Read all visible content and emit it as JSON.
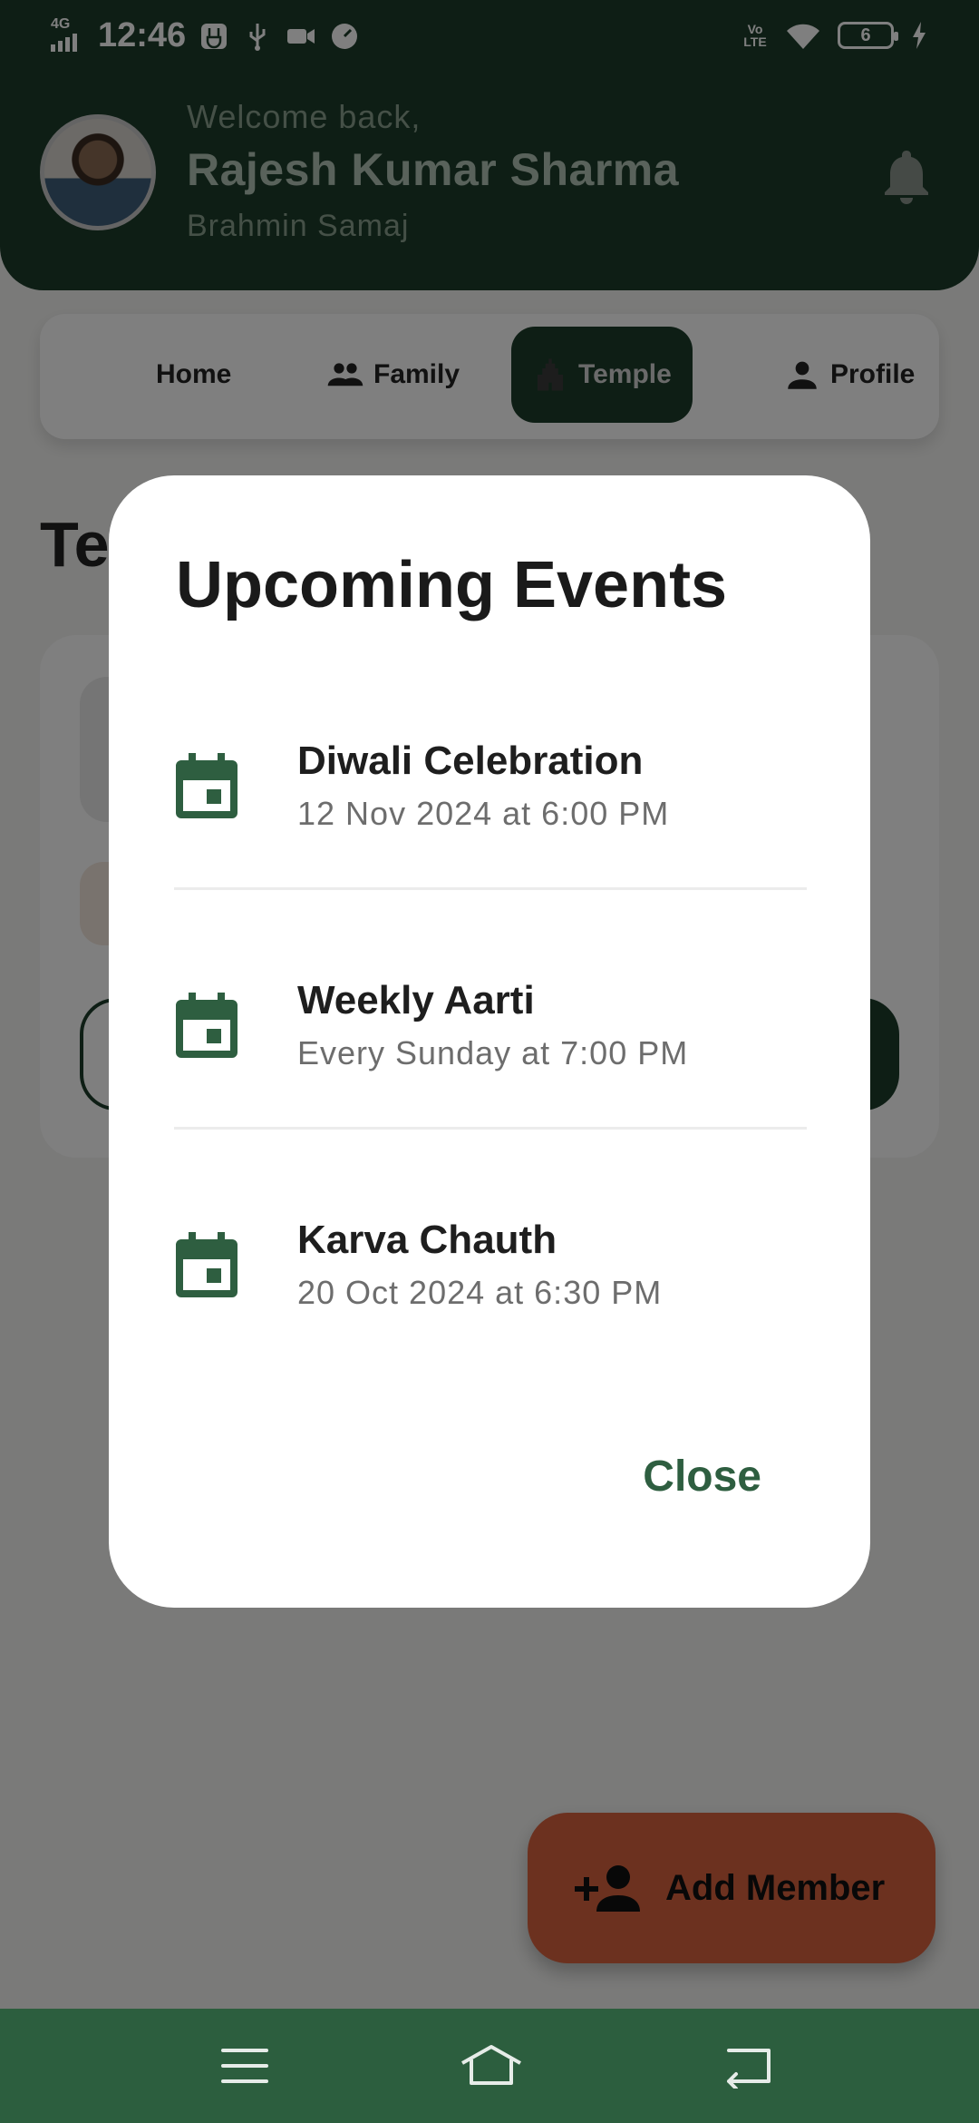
{
  "status_bar": {
    "time": "12:46",
    "network": "4G",
    "volte": "Vo LTE",
    "battery": "6"
  },
  "header": {
    "welcome": "Welcome back,",
    "name": "Rajesh Kumar Sharma",
    "community": "Brahmin Samaj"
  },
  "tabs": [
    {
      "label": "Home",
      "icon": "none"
    },
    {
      "label": "Family",
      "icon": "people-icon"
    },
    {
      "label": "Temple",
      "icon": "temple-icon",
      "active": true
    },
    {
      "label": "Profile",
      "icon": "person-icon"
    }
  ],
  "page": {
    "heading_partial": "Te"
  },
  "fab": {
    "label": "Add Member",
    "icon": "person-add-icon",
    "color": "#d9623f"
  },
  "dialog": {
    "title": "Upcoming Events",
    "events": [
      {
        "name": "Diwali Celebration",
        "time": "12 Nov 2024 at 6:00 PM",
        "icon": "calendar-icon"
      },
      {
        "name": "Weekly Aarti",
        "time": "Every Sunday at 7:00 PM",
        "icon": "calendar-icon"
      },
      {
        "name": "Karva Chauth",
        "time": "20 Oct 2024 at 6:30 PM",
        "icon": "calendar-icon"
      }
    ],
    "close_label": "Close"
  },
  "colors": {
    "primary": "#1c3d2a",
    "accent": "#2e5e40",
    "nav_bar": "#2c5e3e"
  }
}
